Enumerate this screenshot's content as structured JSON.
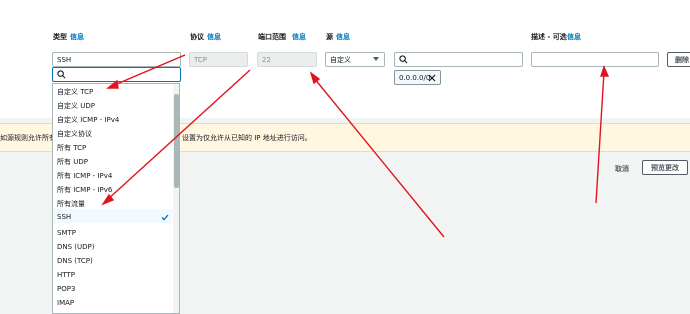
{
  "columns": {
    "type": "类型",
    "protocol": "协议",
    "port_range": "端口范围",
    "source": "源",
    "description": "描述 - 可选"
  },
  "info_label": "信息",
  "type_field": {
    "value": "SSH",
    "search_placeholder": ""
  },
  "protocol_field": {
    "value": "TCP"
  },
  "port_field": {
    "value": "22"
  },
  "source_field": {
    "value": "自定义"
  },
  "source_search": {
    "placeholder": ""
  },
  "source_tag": {
    "value": "0.0.0.0/0"
  },
  "description_field": {
    "value": ""
  },
  "delete_button": "删除",
  "warning_text_left": "如源规则允许所有",
  "warning_text_right": "设置为仅允许从已知的 IP 地址进行访问。",
  "footer": {
    "cancel": "取消",
    "preview": "预览更改"
  },
  "dropdown_items": [
    "自定义 TCP",
    "自定义 UDP",
    "自定义 ICMP - IPv4",
    "自定义协议",
    "所有 TCP",
    "所有 UDP",
    "所有 ICMP - IPv4",
    "所有 ICMP - IPv6",
    "所有流量",
    "SSH",
    "SMTP",
    "DNS (UDP)",
    "DNS (TCP)",
    "HTTP",
    "POP3",
    "IMAP"
  ],
  "selected_item": "SSH",
  "colors": {
    "accent": "#0073bb",
    "annotation": "#e0141e",
    "warning_bg": "#fff7e0"
  }
}
